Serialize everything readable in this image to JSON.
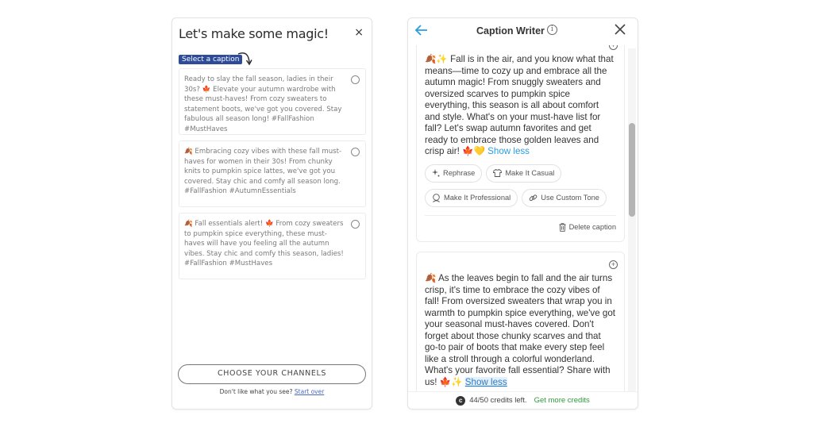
{
  "left_panel": {
    "title": "Let's make some magic!",
    "close_label": "×",
    "select_badge": "Select a caption",
    "captions": [
      {
        "text": "Ready to slay the fall season, ladies in their 30s? 🍁 Elevate your autumn wardrobe with these must-haves! From cozy sweaters to statement boots, we've got you covered. Stay fabulous all season long! #FallFashion #MustHaves",
        "selected": false
      },
      {
        "text": "🍂 Embracing cozy vibes with these fall must-haves for women in their 30s! From chunky knits to pumpkin spice lattes, we've got you covered. Stay chic and comfy all season long. #FallFashion #AutumnEssentials",
        "selected": false
      },
      {
        "text": "🍂 Fall essentials alert! 🍁 From cozy sweaters to pumpkin spice everything, these must-haves will have you feeling all the autumn vibes. Stay chic and comfy this season, ladies! #FallFashion #MustHaves",
        "selected": false
      }
    ],
    "choose_button": "CHOOSE YOUR CHANNELS",
    "dislike_text": "Don't like what you see?",
    "start_over": "Start over"
  },
  "right_panel": {
    "title": "Caption Writer",
    "info_label": "i",
    "cards": [
      {
        "text": "🍂✨ Fall is in the air, and you know what that means—time to cozy up and embrace all the autumn magic! From snuggly sweaters and oversized scarves to pumpkin spice everything, this season is all about comfort and style. What's on your must-have list for fall? Let's swap autumn favorites and get ready to embrace those golden leaves and crisp air! 🍁💛",
        "toggle": "Show less",
        "actions": [
          "Rephrase",
          "Make It Casual",
          "Make It Professional",
          "Use Custom Tone"
        ],
        "delete_label": "Delete caption"
      },
      {
        "text": "🍂 As the leaves begin to fall and the air turns crisp, it's time to embrace the cozy vibes of fall! From oversized sweaters that wrap you in warmth to pumpkin spice everything, we've got your seasonal must-haves covered. Don't forget about those chunky scarves and that go-to pair of boots that make every step feel like a stroll through a colorful wonderland. What's your favorite fall essential? Share with us! 🍁✨",
        "toggle": "Show less"
      }
    ],
    "footer": {
      "credits": "44/50 credits left.",
      "get_more": "Get more credits",
      "credit_icon": "c"
    }
  }
}
